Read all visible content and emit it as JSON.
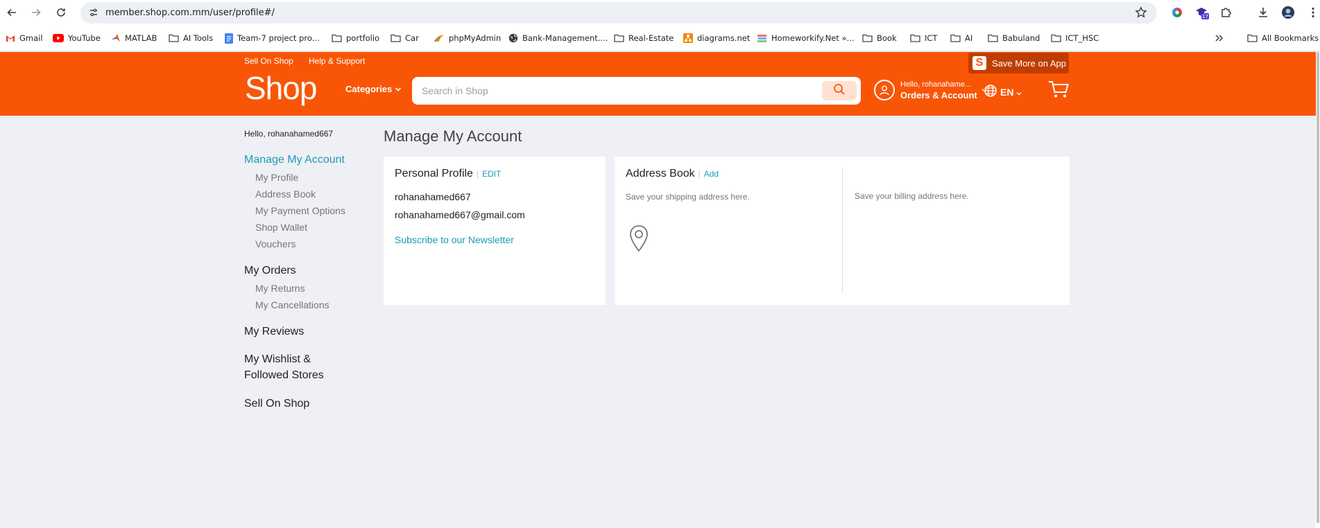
{
  "browser": {
    "url": "member.shop.com.mm/user/profile#/",
    "extension_badge": "17",
    "bookmarks": [
      {
        "label": "Gmail",
        "icon": "gmail-icon"
      },
      {
        "label": "YouTube",
        "icon": "youtube-icon"
      },
      {
        "label": "MATLAB",
        "icon": "matlab-icon"
      },
      {
        "label": "AI Tools",
        "icon": "folder-icon"
      },
      {
        "label": "Team-7 project pro...",
        "icon": "docs-icon"
      },
      {
        "label": "portfolio",
        "icon": "folder-icon"
      },
      {
        "label": "Car",
        "icon": "folder-icon"
      },
      {
        "label": "phpMyAdmin",
        "icon": "phpmyadmin-icon"
      },
      {
        "label": "Bank-Management....",
        "icon": "globe-icon"
      },
      {
        "label": "Real-Estate",
        "icon": "folder-icon"
      },
      {
        "label": "diagrams.net",
        "icon": "diagrams-icon"
      },
      {
        "label": "Homeworkify.Net »...",
        "icon": "books-icon"
      },
      {
        "label": "Book",
        "icon": "folder-icon"
      },
      {
        "label": "ICT",
        "icon": "folder-icon"
      },
      {
        "label": "AI",
        "icon": "folder-icon"
      },
      {
        "label": "Babuland",
        "icon": "folder-icon"
      },
      {
        "label": "ICT_HSC",
        "icon": "folder-icon"
      }
    ],
    "all_bookmarks": "All Bookmarks"
  },
  "header": {
    "top_links": [
      "Sell On Shop",
      "Help & Support"
    ],
    "save_app": "Save More on App",
    "logo": "Shop",
    "categories": "Categories",
    "search_placeholder": "Search in Shop",
    "account_hello": "Hello, rohanahame...",
    "account_orders": "Orders & Account",
    "language": "EN",
    "brand_color": "#f85606",
    "accent_color": "#1a9cb7"
  },
  "sidebar": {
    "hello": "Hello, rohanahamed667",
    "sections": [
      {
        "label": "Manage My Account",
        "active": true,
        "items": [
          "My Profile",
          "Address Book",
          "My Payment Options",
          "Shop Wallet",
          "Vouchers"
        ]
      },
      {
        "label": "My Orders",
        "active": false,
        "items": [
          "My Returns",
          "My Cancellations"
        ]
      },
      {
        "label": "My Reviews",
        "active": false,
        "items": []
      },
      {
        "label_line1": "My Wishlist &",
        "label_line2": "Followed Stores",
        "active": false,
        "items": []
      },
      {
        "label": "Sell On Shop",
        "active": false,
        "items": []
      }
    ]
  },
  "main": {
    "heading": "Manage My Account",
    "profile": {
      "title": "Personal Profile",
      "edit": "EDIT",
      "username": "rohanahamed667",
      "email": "rohanahamed667@gmail.com",
      "newsletter": "Subscribe to our Newsletter"
    },
    "address_book": {
      "title": "Address Book",
      "add": "Add",
      "shipping_note": "Save your shipping address here.",
      "billing_note": "Save your billing address here."
    }
  }
}
